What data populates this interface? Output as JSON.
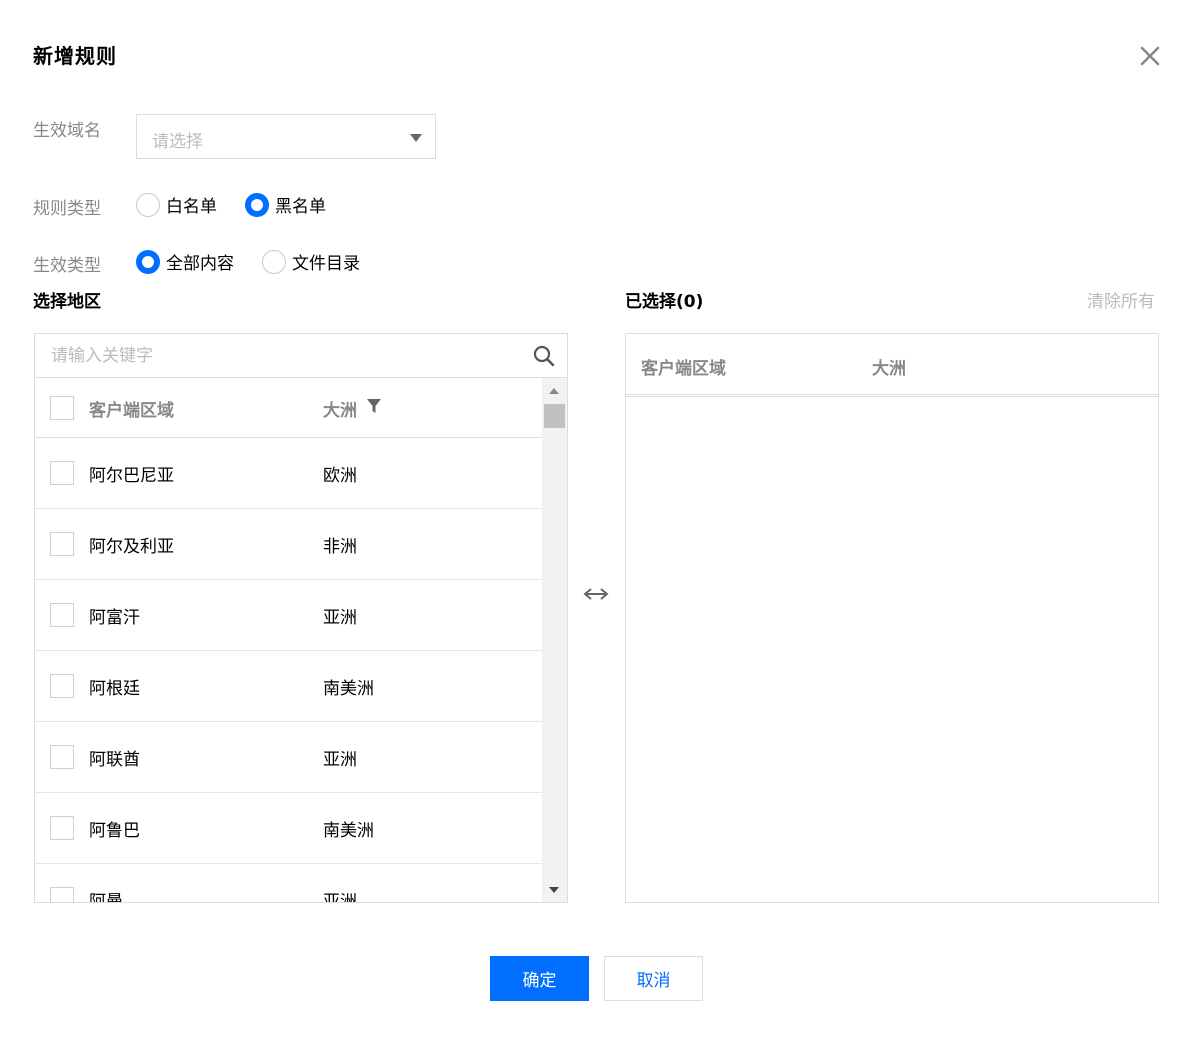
{
  "dialog": {
    "title": "新增规则"
  },
  "form": {
    "domain_label": "生效域名",
    "domain_placeholder": "请选择",
    "rule_type_label": "规则类型",
    "rule_type_options": [
      "白名单",
      "黑名单"
    ],
    "rule_type_selected": "黑名单",
    "effect_type_label": "生效类型",
    "effect_type_options": [
      "全部内容",
      "文件目录"
    ],
    "effect_type_selected": "全部内容"
  },
  "left": {
    "title": "选择地区",
    "search_placeholder": "请输入关键字",
    "col_region": "客户端区域",
    "col_continent": "大洲",
    "rows": [
      {
        "region": "阿尔巴尼亚",
        "continent": "欧洲"
      },
      {
        "region": "阿尔及利亚",
        "continent": "非洲"
      },
      {
        "region": "阿富汗",
        "continent": "亚洲"
      },
      {
        "region": "阿根廷",
        "continent": "南美洲"
      },
      {
        "region": "阿联酋",
        "continent": "亚洲"
      },
      {
        "region": "阿鲁巴",
        "continent": "南美洲"
      },
      {
        "region": "阿曼",
        "continent": "亚洲"
      }
    ]
  },
  "right": {
    "title": "已选择(0)",
    "clear_all": "清除所有",
    "col_region": "客户端区域",
    "col_continent": "大洲"
  },
  "footer": {
    "ok_label": "确定",
    "cancel_label": "取消"
  },
  "colors": {
    "primary": "#006eff",
    "border": "#dcdcdc",
    "muted_text": "#888888"
  }
}
